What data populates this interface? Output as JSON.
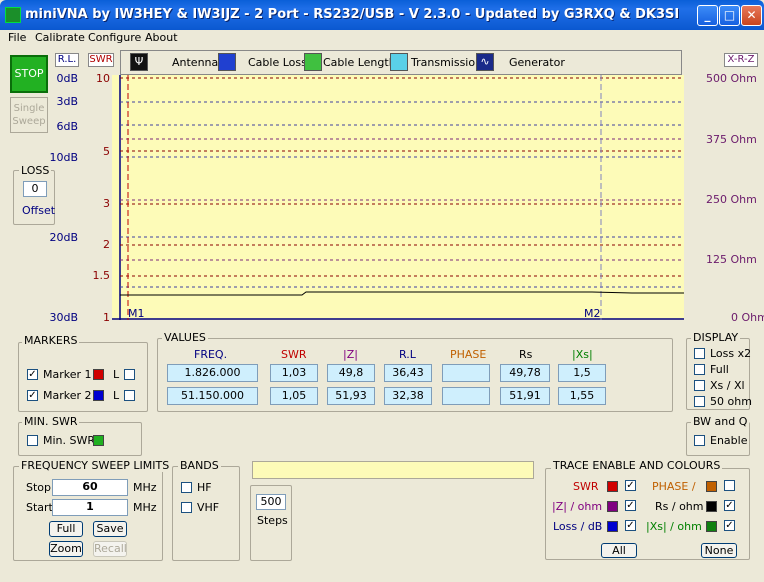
{
  "window": {
    "title": "miniVNA by IW3HEY & IW3IJZ - 2 Port - RS232/USB - V 2.3.0 - Updated by G3RXQ & DK3SI"
  },
  "menu": [
    "File",
    "Calibrate",
    "Configure",
    "About"
  ],
  "toolbar": [
    "Antenna",
    "Cable Loss",
    "Cable Length",
    "Transmission",
    "Generator"
  ],
  "left": {
    "stop_label": "STOP",
    "single_label_1": "Single",
    "single_label_2": "Sweep",
    "loss_title": "LOSS",
    "loss_value": "0",
    "offset_label": "Offset"
  },
  "scale_headers": {
    "rl": "R.L.",
    "swr": "SWR",
    "xrz": "X-R-Z"
  },
  "rl_ticks": [
    "0dB",
    "3dB",
    "6dB",
    "10dB",
    "20dB",
    "30dB"
  ],
  "swr_ticks": [
    "10",
    "5",
    "3",
    "2",
    "1.5",
    "1"
  ],
  "ohm_ticks": [
    "500 Ohm",
    "375 Ohm",
    "250 Ohm",
    "125 Ohm",
    "0 Ohm"
  ],
  "plot": {
    "marker1_label": "M1",
    "marker2_label": "M2",
    "bg_color": "#fdfbb8",
    "axis_color": "#000080",
    "swr_color": "#c00000"
  },
  "markers": {
    "title": "MARKERS",
    "m1_label": "Marker 1",
    "m2_label": "Marker 2",
    "l_label": "L",
    "m1_color": "#d00000",
    "m2_color": "#0000d0"
  },
  "values": {
    "title": "VALUES",
    "headers": [
      "FREQ.",
      "SWR",
      "|Z|",
      "R.L",
      "PHASE",
      "Rs",
      "|Xs|"
    ],
    "row1": [
      "1.826.000",
      "1,03",
      "49,8",
      "36,43",
      "",
      "49,78",
      "1,5"
    ],
    "row2": [
      "51.150.000",
      "1,05",
      "51,93",
      "32,38",
      "",
      "51,91",
      "1,55"
    ]
  },
  "display": {
    "title": "DISPLAY",
    "items": [
      "Loss x2",
      "Full",
      "Xs / Xl",
      "50 ohm"
    ]
  },
  "minswr": {
    "title": "MIN. SWR",
    "label": "Min. SWR"
  },
  "bwq": {
    "title": "BW and Q",
    "label": "Enable"
  },
  "sweep": {
    "title": "FREQUENCY SWEEP LIMITS",
    "stop_label": "Stop",
    "start_label": "Start",
    "stop_value": "60",
    "start_value": "1",
    "unit": "MHz",
    "full": "Full",
    "save": "Save",
    "zoom": "Zoom",
    "recall": "Recall"
  },
  "bands": {
    "title": "BANDS",
    "hf": "HF",
    "vhf": "VHF"
  },
  "steps": {
    "value": "500",
    "label": "Steps"
  },
  "trace": {
    "title": "TRACE ENABLE AND COLOURS",
    "swr": "SWR",
    "z": "|Z| / ohm",
    "loss": "Loss / dB",
    "phase": "PHASE /",
    "rs": "Rs / ohm",
    "xs": "|Xs| / ohm",
    "all": "All",
    "none": "None"
  }
}
